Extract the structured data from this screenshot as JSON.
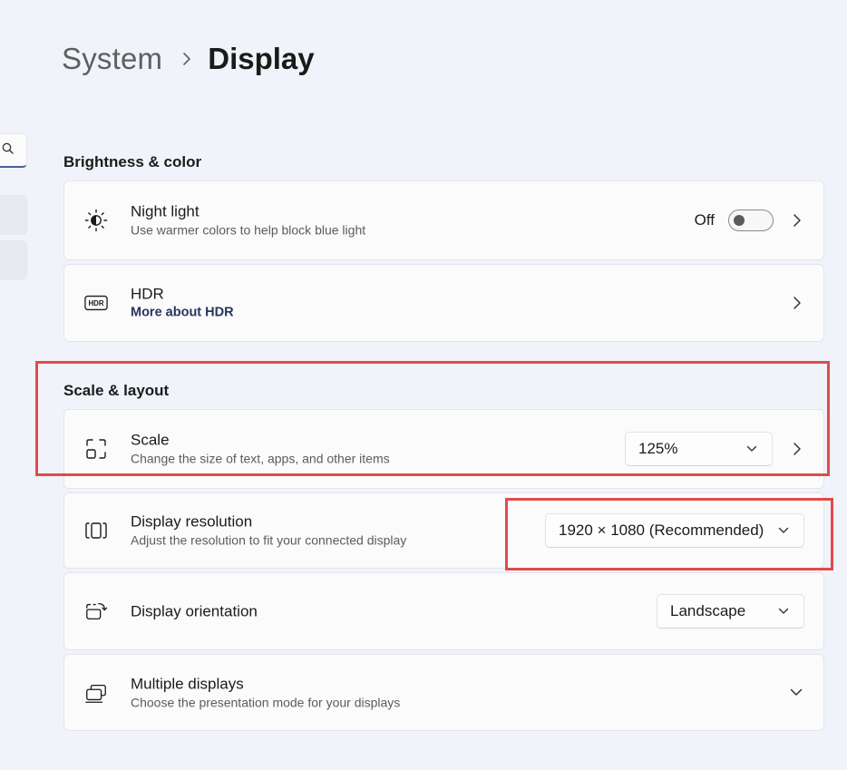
{
  "breadcrumb": {
    "parent": "System",
    "current": "Display"
  },
  "sidebar": {
    "search_icon": "search-icon"
  },
  "sections": {
    "brightness": "Brightness & color",
    "scale_layout": "Scale & layout"
  },
  "night_light": {
    "title": "Night light",
    "subtitle": "Use warmer colors to help block blue light",
    "state_label": "Off",
    "icon": "brightness-icon"
  },
  "hdr": {
    "title": "HDR",
    "link": "More about HDR",
    "icon_text": "HDR"
  },
  "scale": {
    "title": "Scale",
    "subtitle": "Change the size of text, apps, and other items",
    "value": "125%"
  },
  "resolution": {
    "title": "Display resolution",
    "subtitle": "Adjust the resolution to fit your connected display",
    "value": "1920 × 1080 (Recommended)"
  },
  "orientation": {
    "title": "Display orientation",
    "value": "Landscape"
  },
  "multiple": {
    "title": "Multiple displays",
    "subtitle": "Choose the presentation mode for your displays"
  },
  "colors": {
    "background": "#f0f3f9",
    "card": "#fbfbfc",
    "highlight": "#e24a4a",
    "link": "#26355a"
  }
}
